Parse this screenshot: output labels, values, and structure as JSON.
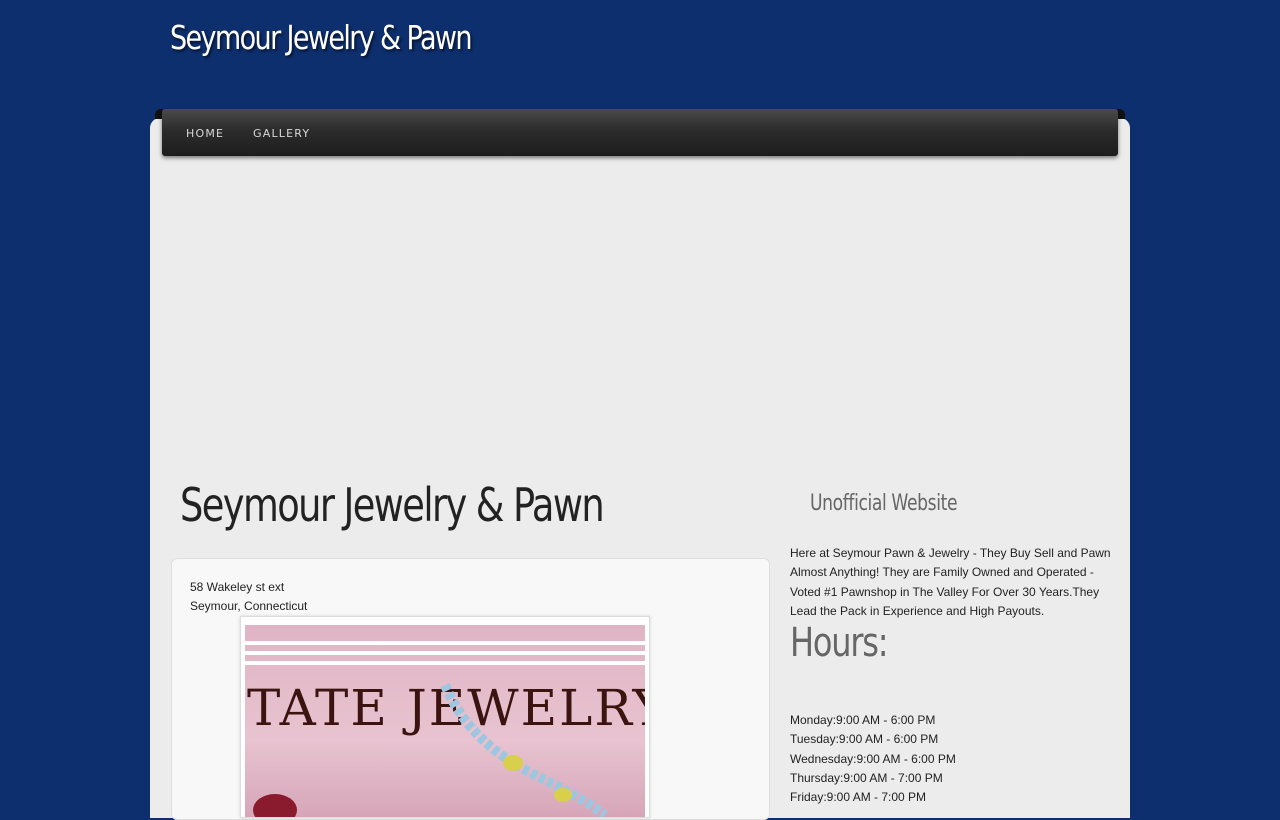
{
  "site": {
    "title": "Seymour Jewelry & Pawn"
  },
  "nav": {
    "items": [
      {
        "label": "HOME"
      },
      {
        "label": "GALLERY"
      }
    ]
  },
  "main": {
    "heading": "Seymour Jewelry & Pawn",
    "address": {
      "line1": "58 Wakeley st ext",
      "line2": "Seymour, Connecticut"
    },
    "image": {
      "text": "TATE JEWELRY"
    }
  },
  "sidebar": {
    "title": "Unofficial Website",
    "about": "Here at Seymour Pawn & Jewelry - They Buy Sell and Pawn Almost Anything! They are Family Owned and Operated - Voted #1 Pawnshop in The Valley For Over 30 Years.They Lead the Pack in Experience and High Payouts.",
    "hours_heading": "Hours:",
    "hours": [
      "Monday:9:00 AM - 6:00 PM",
      "Tuesday:9:00 AM - 6:00 PM",
      "Wednesday:9:00 AM - 6:00 PM",
      "Thursday:9:00 AM - 7:00 PM",
      "Friday:9:00 AM - 7:00 PM"
    ]
  },
  "colors": {
    "background": "#0e2f6e",
    "panel": "#ececec",
    "nav": "#2c2c2c"
  }
}
